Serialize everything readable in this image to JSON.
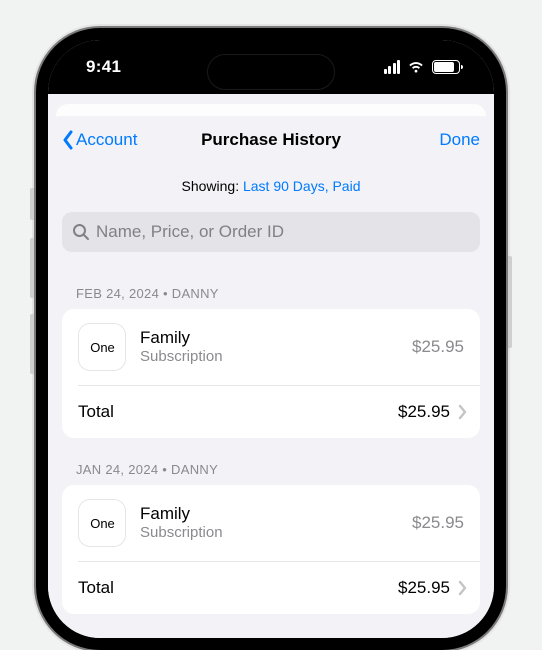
{
  "status": {
    "time": "9:41"
  },
  "nav": {
    "back_label": "Account",
    "title": "Purchase History",
    "done_label": "Done"
  },
  "filter": {
    "prefix": "Showing: ",
    "value": "Last 90 Days, Paid"
  },
  "search": {
    "placeholder": "Name, Price, or Order ID"
  },
  "groups": [
    {
      "header": "FEB 24, 2024  •  Danny",
      "item": {
        "icon_text": "One",
        "title": "Family",
        "subtitle": "Subscription",
        "price": "$25.95"
      },
      "total_label": "Total",
      "total_value": "$25.95"
    },
    {
      "header": "JAN 24, 2024  •  Danny",
      "item": {
        "icon_text": "One",
        "title": "Family",
        "subtitle": "Subscription",
        "price": "$25.95"
      },
      "total_label": "Total",
      "total_value": "$25.95"
    }
  ]
}
